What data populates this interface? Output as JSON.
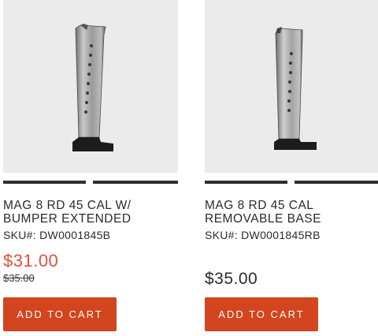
{
  "products": [
    {
      "title_line1": "MAG 8 RD 45 CAL W/",
      "title_line2": "BUMPER EXTENDED",
      "sku": "SKU#: DW0001845B",
      "sale_price": "$31.00",
      "original_price": "$35.00",
      "button_label": "ADD TO CART",
      "image_icon": "magazine-bumper-extended"
    },
    {
      "title_line1": "MAG 8 RD 45 CAL",
      "title_line2": "REMOVABLE BASE",
      "sku": "SKU#: DW0001845RB",
      "price": "$35.00",
      "button_label": "ADD TO CART",
      "image_icon": "magazine-removable-base"
    }
  ],
  "colors": {
    "accent": "#d2451e",
    "sale_price": "#e0513a",
    "image_background": "#ebebeb",
    "bar": "#2f2f2f"
  }
}
